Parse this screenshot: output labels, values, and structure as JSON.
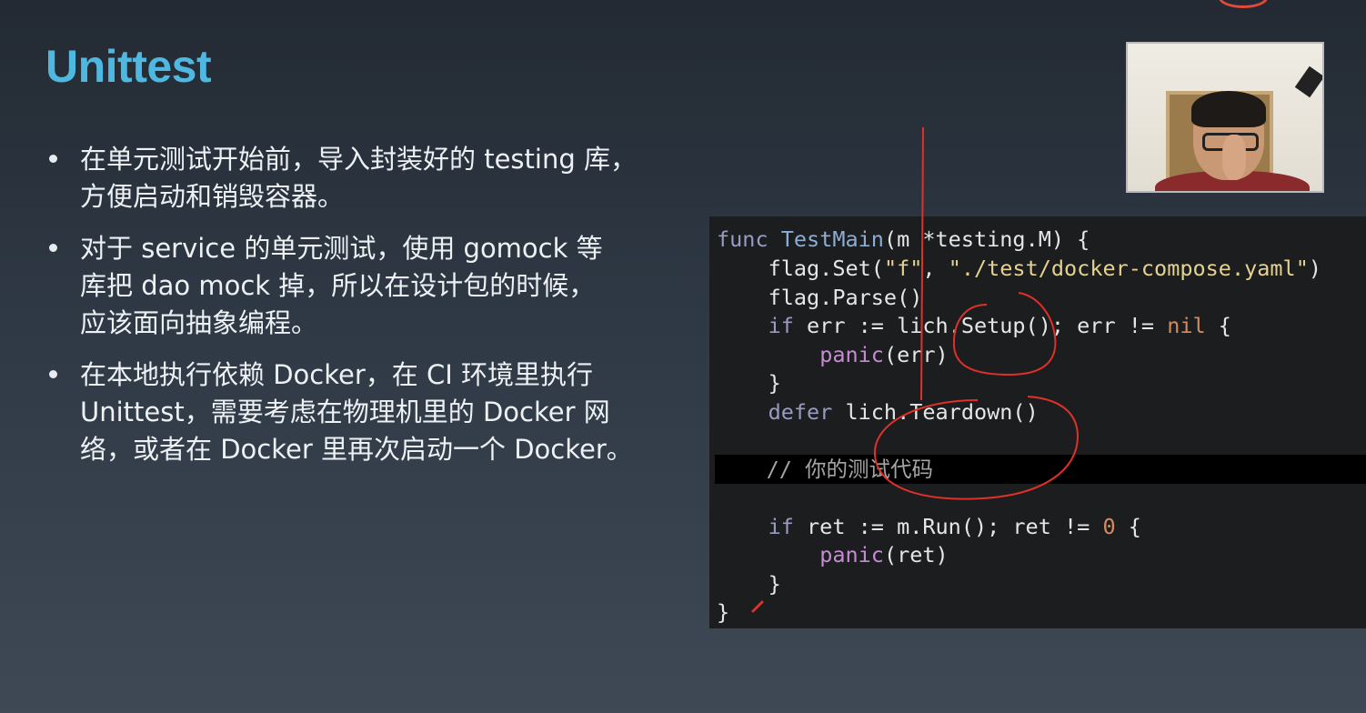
{
  "slide": {
    "title": "Unittest",
    "bullets": [
      {
        "lines": [
          "在单元测试开始前，导入封装好的 testing 库，",
          "方便启动和销毁容器。"
        ]
      },
      {
        "lines": [
          "对于 service 的单元测试，使用 gomock 等",
          "库把 dao mock 掉，所以在设计包的时候，",
          "应该面向抽象编程。"
        ]
      },
      {
        "lines": [
          "在本地执行依赖 Docker，在 CI 环境里执行",
          "Unittest，需要考虑在物理机里的 Docker 网",
          "络，或者在 Docker 里再次启动一个 Docker。"
        ]
      }
    ]
  },
  "webcam": {
    "name": "presenter-video"
  },
  "code": {
    "line1": {
      "kw": "func",
      "name": "TestMain",
      "rest": "(m *testing.M) {"
    },
    "line2": {
      "indent": "    ",
      "a": "flag.Set(",
      "s1": "\"f\"",
      "b": ", ",
      "s2": "\"./test/docker-compose.yaml\"",
      "c": ")"
    },
    "line3": {
      "text": "    flag.Parse()"
    },
    "line4": {
      "indent": "    ",
      "kw": "if",
      "a": " err := lich.Setup(); err != ",
      "nil": "nil",
      "b": " {"
    },
    "line5": {
      "indent": "        ",
      "builtin": "panic",
      "rest": "(err)"
    },
    "line6": {
      "text": "    }"
    },
    "line7": {
      "indent": "    ",
      "kw": "defer",
      "rest": " lich.Teardown()"
    },
    "line8": {
      "text": ""
    },
    "line9": {
      "text": "    // 你的测试代码"
    },
    "line10": {
      "text": ""
    },
    "line11": {
      "indent": "    ",
      "kw": "if",
      "a": " ret := m.Run(); ret != ",
      "num": "0",
      "b": " {"
    },
    "line12": {
      "indent": "        ",
      "builtin": "panic",
      "rest": "(ret)"
    },
    "line13": {
      "text": "    }"
    },
    "line14": {
      "text": "}"
    }
  },
  "colors": {
    "title": "#4fb8e1",
    "annotation": "#e0302a",
    "code_bg": "#1c1d1f"
  }
}
